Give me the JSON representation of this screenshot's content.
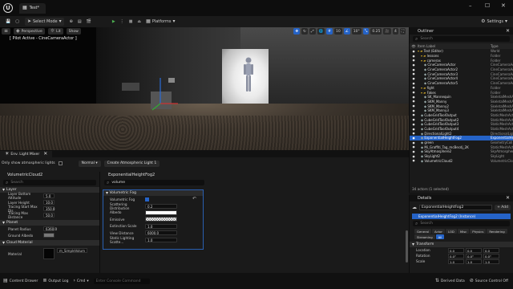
{
  "titlebar": {
    "project_tab": "Test*",
    "controls": [
      "–",
      "☐",
      "✕"
    ]
  },
  "toolbar": {
    "select_mode": "Select Mode",
    "platforms": "Platforms",
    "settings": "Settings"
  },
  "viewport": {
    "buttons": [
      "Perspective",
      "Lit",
      "Show"
    ],
    "pilot_label": "[ Pilot Active - CineCameraActor ]",
    "right_controls": [
      "10",
      "10°",
      "0.25",
      "4"
    ]
  },
  "light_mixer": {
    "tab_label": "Env. Light Mixer",
    "only_show_label": "Only show atmospheric lights",
    "mode_value": "Normal",
    "create_button": "Create Atmospheric Light 1",
    "cloud": {
      "title": "VolumetricCloud2",
      "search_placeholder": "Search",
      "layer_section": "Layer",
      "layer_rows": [
        {
          "label": "Layer Bottom Altitude",
          "value": "5.0"
        },
        {
          "label": "Layer Height",
          "value": "10.0"
        },
        {
          "label": "Tracing Start Max Dis",
          "value": "350.0"
        },
        {
          "label": "Tracing Max Distance",
          "value": "50.0"
        }
      ],
      "planet_section": "Planet",
      "planet_rows": [
        {
          "label": "Planet Radius",
          "value": "6360.0"
        },
        {
          "label": "Ground Albedo",
          "value": ""
        }
      ],
      "material_section": "Cloud Material",
      "material_label": "Material",
      "material_value": "m_SimpleVolum"
    },
    "fog": {
      "title": "ExponentialHeightFog2",
      "search_value": "volume",
      "section": "Volumetric Fog",
      "rows": [
        {
          "label": "Volumetric Fog",
          "value": ""
        },
        {
          "label": "Scattering Distribution",
          "value": "0.2"
        },
        {
          "label": "Albedo",
          "value": ""
        },
        {
          "label": "Emissive",
          "value": ""
        },
        {
          "label": "Extinction Scale",
          "value": "1.0"
        },
        {
          "label": "View Distance",
          "value": "6000.0"
        },
        {
          "label": "Static Lighting Scatte...",
          "value": "1.0"
        }
      ]
    }
  },
  "bottom_bar": {
    "content_drawer": "Content Drawer",
    "output_log": "Output Log",
    "cmd": "Cmd",
    "cmd_placeholder": "Enter Console Command",
    "derived_data": "Derived Data",
    "source_control": "Source Control Off"
  },
  "outliner": {
    "title": "Outliner",
    "search_placeholder": "Search",
    "col_label": "Item Label",
    "col_type": "Type",
    "items": [
      {
        "name": "Test (Editor)",
        "type": "World"
      },
      {
        "name": "lessons",
        "type": "Folder"
      },
      {
        "name": "cameras",
        "type": "Folder"
      },
      {
        "name": "CineCameraActor",
        "type": "CineCameraAct"
      },
      {
        "name": "CineCameraActor2",
        "type": "CineCameraAct"
      },
      {
        "name": "CineCameraActor3",
        "type": "CineCameraAct"
      },
      {
        "name": "CineCameraActor4",
        "type": "CineCameraAct"
      },
      {
        "name": "CineCameraActor5",
        "type": "CineCameraAct"
      },
      {
        "name": "fight",
        "type": "Folder"
      },
      {
        "name": "Fakes",
        "type": "Folder"
      },
      {
        "name": "SK_Mannequin",
        "type": "SkeletalMeshA"
      },
      {
        "name": "SKM_Manny",
        "type": "SkeletalMeshA"
      },
      {
        "name": "SKM_Manny2",
        "type": "SkeletalMeshA"
      },
      {
        "name": "SKM_Manny3",
        "type": "SkeletalMeshA"
      },
      {
        "name": "CubeGridToolOutput",
        "type": "StaticMeshAct"
      },
      {
        "name": "CubeGridToolOutput2",
        "type": "StaticMeshAct"
      },
      {
        "name": "CubeGridToolOutput3",
        "type": "StaticMeshAct"
      },
      {
        "name": "CubeGridToolOutput4",
        "type": "StaticMeshAct"
      },
      {
        "name": "DirectionalLight2",
        "type": "DirectionalLigh"
      },
      {
        "name": "ExponentialHeightFog2",
        "type": "ExponentialHei"
      },
      {
        "name": "green",
        "type": "GeometryColl"
      },
      {
        "name": "Mi_Graffiti_Tag_mcBecdj_2K",
        "type": "StaticMeshAct"
      },
      {
        "name": "SkyAtmosphere2",
        "type": "SkyAtmosphere"
      },
      {
        "name": "SkyLight2",
        "type": "SkyLight"
      },
      {
        "name": "VolumetricCloud2",
        "type": "VolumetricClou"
      }
    ],
    "footer": "34 actors (1 selected)"
  },
  "details": {
    "title": "Details",
    "actor_name": "ExponentialHeightFog2",
    "add_label": "+ Add",
    "component": "ExponentialHeightFog2 (Instance)",
    "search_placeholder": "Search",
    "filters": [
      "General",
      "Actor",
      "LOD",
      "Misc",
      "Physics",
      "Rendering",
      "Streaming",
      "All"
    ],
    "transform_section": "Transform",
    "transform_rows": [
      {
        "label": "Location",
        "values": [
          "0.0",
          "0.0",
          "0.0"
        ]
      },
      {
        "label": "Rotation",
        "values": [
          "0.0°",
          "0.0°",
          "0.0°"
        ]
      },
      {
        "label": "Scale",
        "values": [
          "1.0",
          "1.0",
          "1.0"
        ]
      }
    ]
  }
}
